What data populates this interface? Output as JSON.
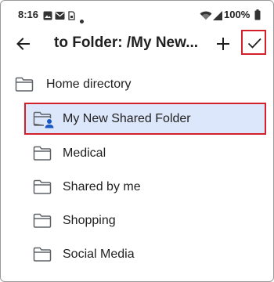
{
  "status_bar": {
    "time": "8:16",
    "battery": "100%",
    "icons": [
      "gallery-icon",
      "mail-icon",
      "sim-icon",
      "dot-icon",
      "wifi-icon",
      "signal-icon",
      "battery-icon"
    ]
  },
  "app_bar": {
    "title": "to Folder: /My New...",
    "back_icon": "arrow-left-icon",
    "add_icon": "plus-icon",
    "confirm_icon": "check-icon"
  },
  "folders": {
    "home": {
      "label": "Home directory"
    },
    "items": [
      {
        "label": "My New Shared Folder",
        "shared": true,
        "selected": true
      },
      {
        "label": "Medical"
      },
      {
        "label": "Shared by me"
      },
      {
        "label": "Shopping"
      },
      {
        "label": "Social Media"
      }
    ]
  },
  "colors": {
    "selection_bg": "#dde7fb",
    "highlight_border": "#d3202a",
    "folder_stroke": "#5f6368",
    "shared_badge": "#1a56c4"
  }
}
